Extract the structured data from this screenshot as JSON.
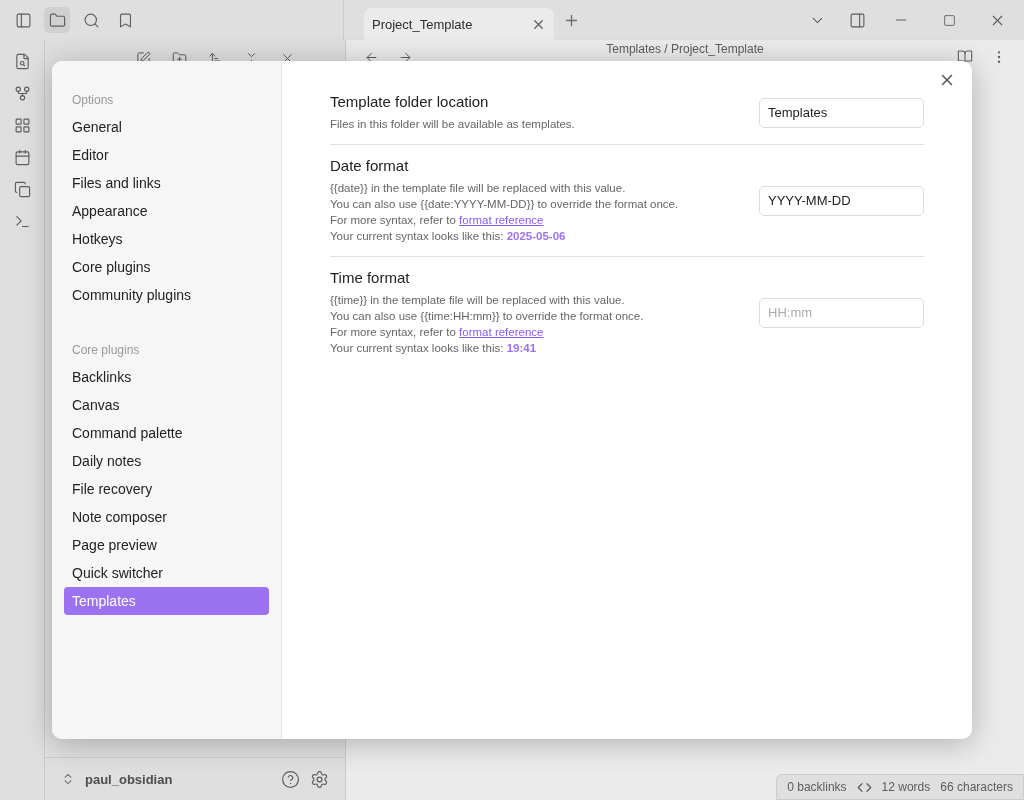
{
  "tab": {
    "title": "Project_Template"
  },
  "breadcrumb": {
    "parent": "Templates",
    "separator": "/",
    "current": "Project_Template"
  },
  "vault": {
    "name": "paul_obsidian"
  },
  "status_bar": {
    "backlinks": "0 backlinks",
    "words": "12 words",
    "characters": "66 characters"
  },
  "settings_nav": [
    {
      "heading": "Options",
      "items": [
        {
          "label": "General",
          "selected": false
        },
        {
          "label": "Editor",
          "selected": false
        },
        {
          "label": "Files and links",
          "selected": false
        },
        {
          "label": "Appearance",
          "selected": false
        },
        {
          "label": "Hotkeys",
          "selected": false
        },
        {
          "label": "Core plugins",
          "selected": false
        },
        {
          "label": "Community plugins",
          "selected": false
        }
      ]
    },
    {
      "heading": "Core plugins",
      "items": [
        {
          "label": "Backlinks",
          "selected": false
        },
        {
          "label": "Canvas",
          "selected": false
        },
        {
          "label": "Command palette",
          "selected": false
        },
        {
          "label": "Daily notes",
          "selected": false
        },
        {
          "label": "File recovery",
          "selected": false
        },
        {
          "label": "Note composer",
          "selected": false
        },
        {
          "label": "Page preview",
          "selected": false
        },
        {
          "label": "Quick switcher",
          "selected": false
        },
        {
          "label": "Templates",
          "selected": true
        }
      ]
    }
  ],
  "settings": [
    {
      "name": "Template folder location",
      "description": [
        {
          "text": "Files in this folder will be available as templates."
        }
      ],
      "value": "Templates"
    },
    {
      "name": "Date format",
      "description": [
        {
          "text": "{{date}} in the template file will be replaced with this value."
        },
        {
          "text": "You can also use {{date:YYYY-MM-DD}} to override the format once."
        },
        {
          "text": "For more syntax, refer to ",
          "link": "format reference"
        },
        {
          "text": "Your current syntax looks like this: ",
          "sample": "2025-05-06"
        }
      ],
      "value": "YYYY-MM-DD"
    },
    {
      "name": "Time format",
      "description": [
        {
          "text": "{{time}} in the template file will be replaced with this value."
        },
        {
          "text": "You can also use {{time:HH:mm}} to override the format once."
        },
        {
          "text": "For more syntax, refer to ",
          "link": "format reference"
        },
        {
          "text": "Your current syntax looks like this: ",
          "sample": "19:41"
        }
      ],
      "placeholder": "HH:mm"
    }
  ]
}
